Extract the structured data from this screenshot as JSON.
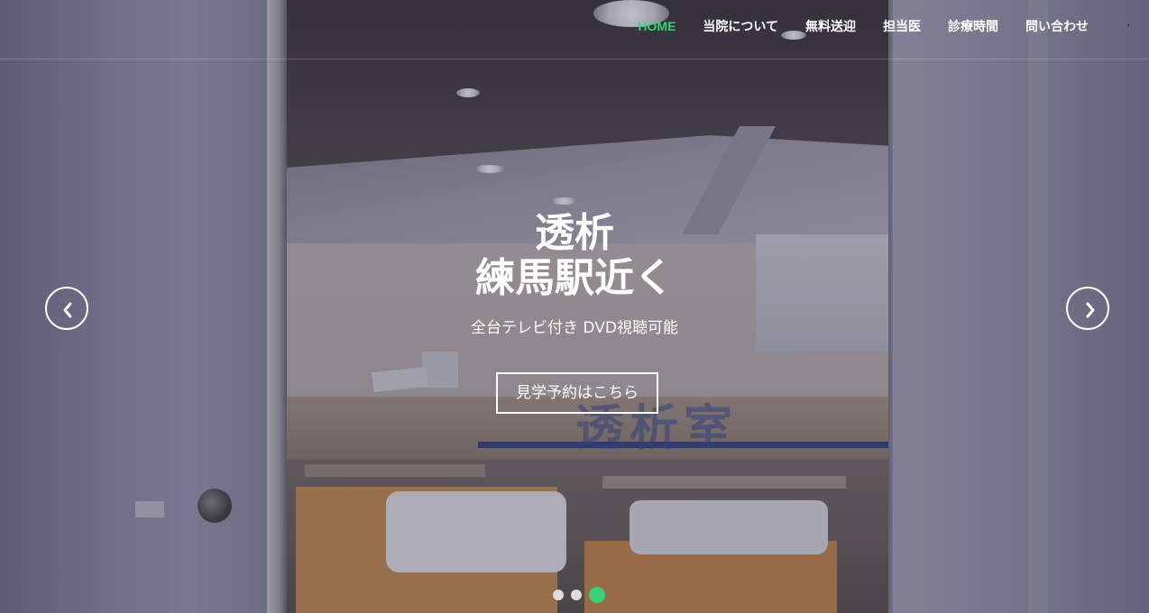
{
  "nav": {
    "items": [
      {
        "label": "HOME",
        "active": true
      },
      {
        "label": "当院について",
        "active": false
      },
      {
        "label": "無料送迎",
        "active": false
      },
      {
        "label": "担当医",
        "active": false
      },
      {
        "label": "診療時間",
        "active": false
      },
      {
        "label": "問い合わせ",
        "active": false
      }
    ],
    "active_color": "#3ccf7a"
  },
  "hero": {
    "title_line1": "透析",
    "title_line2": "練馬駅近く",
    "subtitle": "全台テレビ付き DVD視聴可能",
    "cta_label": "見学予約はこちら",
    "background_glass_text": "透析室"
  },
  "carousel": {
    "prev_icon": "chevron-left-icon",
    "next_icon": "chevron-right-icon",
    "slide_count": 3,
    "active_slide": 3
  }
}
